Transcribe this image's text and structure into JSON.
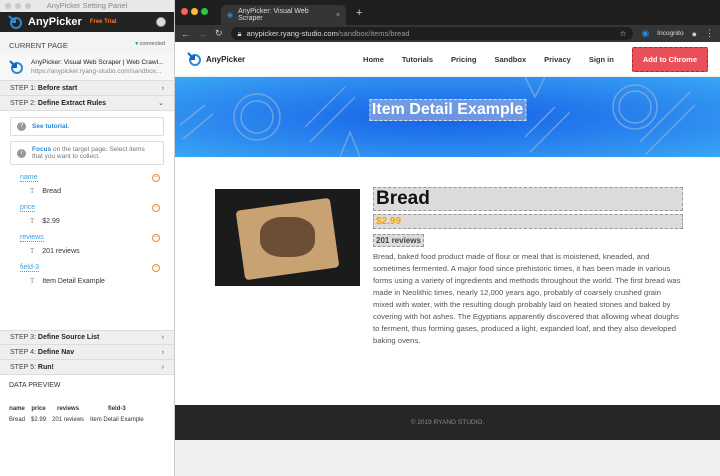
{
  "panel": {
    "window_title": "AnyPicker Setting Panel",
    "app_name": "AnyPicker",
    "badge": "Free Trial",
    "current_page_label": "CURRENT PAGE",
    "status": "connected",
    "page_title": "AnyPicker: Visual Web Scraper | Web Crawl...",
    "page_url": "https://anypicker.ryang-studio.com/sandbox...",
    "steps": [
      {
        "prefix": "STEP 1:",
        "label": "Before start"
      },
      {
        "prefix": "STEP 2:",
        "label": "Define Extract Rules"
      },
      {
        "prefix": "STEP 3:",
        "label": "Define Source List"
      },
      {
        "prefix": "STEP 4:",
        "label": "Define Nav"
      },
      {
        "prefix": "STEP 5:",
        "label": "Run!"
      }
    ],
    "tutorial": "See tutorial.",
    "focus_bold": "Focus",
    "focus_text": " on the target page. Select items that you want to collect.",
    "fields": [
      {
        "name": "name",
        "value": "Bread"
      },
      {
        "name": "price",
        "value": "$2.99"
      },
      {
        "name": "reviews",
        "value": "201 reviews"
      },
      {
        "name": "field-3",
        "value": "Item Detail Example"
      }
    ],
    "preview_label": "DATA PREVIEW",
    "preview_headers": [
      "name",
      "price",
      "reviews",
      "field-3"
    ],
    "preview_row": [
      "Bread",
      "$2.99",
      "201 reviews",
      "Item Detail Example"
    ]
  },
  "browser": {
    "tab_title": "AnyPicker: Visual Web Scraper",
    "url_host": "anypicker.ryang-studio.com",
    "url_path": "/sandbox/items/bread",
    "incognito": "Incognito"
  },
  "site": {
    "logo": "AnyPicker",
    "nav": [
      "Home",
      "Tutorials",
      "Pricing",
      "Sandbox",
      "Privacy",
      "Sign in"
    ],
    "cta": "Add to Chrome",
    "banner_title": "Item Detail Example",
    "product": {
      "name": "Bread",
      "price": "$2.99",
      "reviews": "201 reviews",
      "description": "Bread, baked food product made of flour or meal that is moistened, kneaded, and sometimes fermented. A major food since prehistoric times, it has been made in various forms using a variety of ingredients and methods throughout the world. The first bread was made in Neolithic times, nearly 12,000 years ago, probably of coarsely crushed grain mixed with water, with the resulting dough probably laid on heated stones and baked by covering with hot ashes. The Egyptians apparently discovered that allowing wheat doughs to ferment, thus forming gases, produced a light, expanded loaf, and they also developed baking ovens."
    },
    "footer": "© 2019 RYANG STUDIO."
  },
  "colors": {
    "accent": "#2a8ad8",
    "cta": "#e9505a",
    "price": "#f2a30f"
  }
}
